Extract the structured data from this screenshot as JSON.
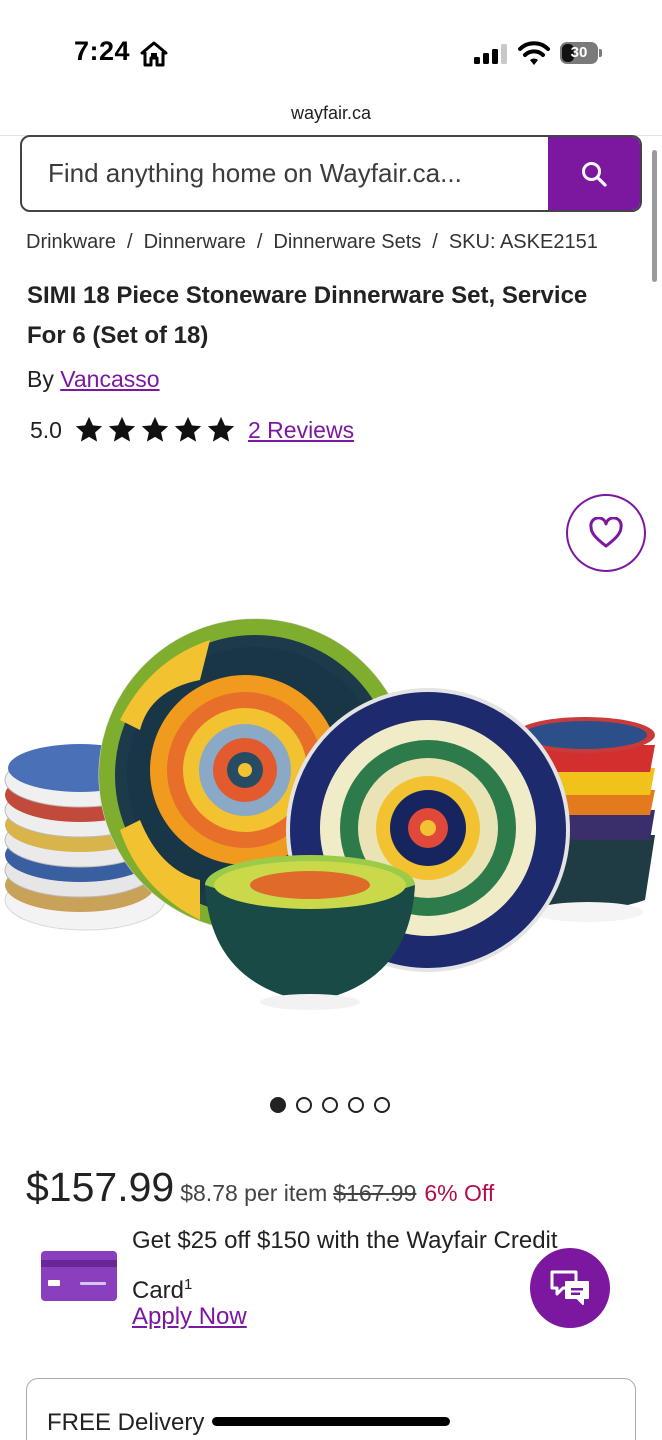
{
  "status_bar": {
    "time": "7:24",
    "battery": "30",
    "icons": [
      "home-icon",
      "signal-icon",
      "wifi-icon",
      "battery-icon"
    ]
  },
  "browser": {
    "url": "wayfair.ca"
  },
  "search": {
    "placeholder": "Find anything home on Wayfair.ca...",
    "icon": "search-icon"
  },
  "breadcrumb": {
    "items": [
      "Drinkware",
      "Dinnerware",
      "Dinnerware Sets"
    ],
    "separator": "/",
    "sku": "SKU: ASKE2151"
  },
  "product": {
    "title": "SIMI 18 Piece Stoneware Dinnerware Set, Service For 6 (Set of 18)",
    "by_label": "By",
    "brand": "Vancasso",
    "rating": "5.0",
    "rating_stars": 5,
    "reviews_label": "2 Reviews"
  },
  "gallery": {
    "image_count": 5,
    "active_index": 0
  },
  "price": {
    "current": "$157.99",
    "per_item": "$8.78 per item",
    "original": "$167.99",
    "discount": "6% Off"
  },
  "promo": {
    "text": "Get $25 off $150 with the Wayfair Credit Card",
    "footnote": "1",
    "apply_label": "Apply Now"
  },
  "delivery": {
    "label": "FREE Delivery"
  },
  "colors": {
    "brand_purple": "#7b189f",
    "discount_red": "#b40d4b",
    "text_dark": "#222222"
  }
}
